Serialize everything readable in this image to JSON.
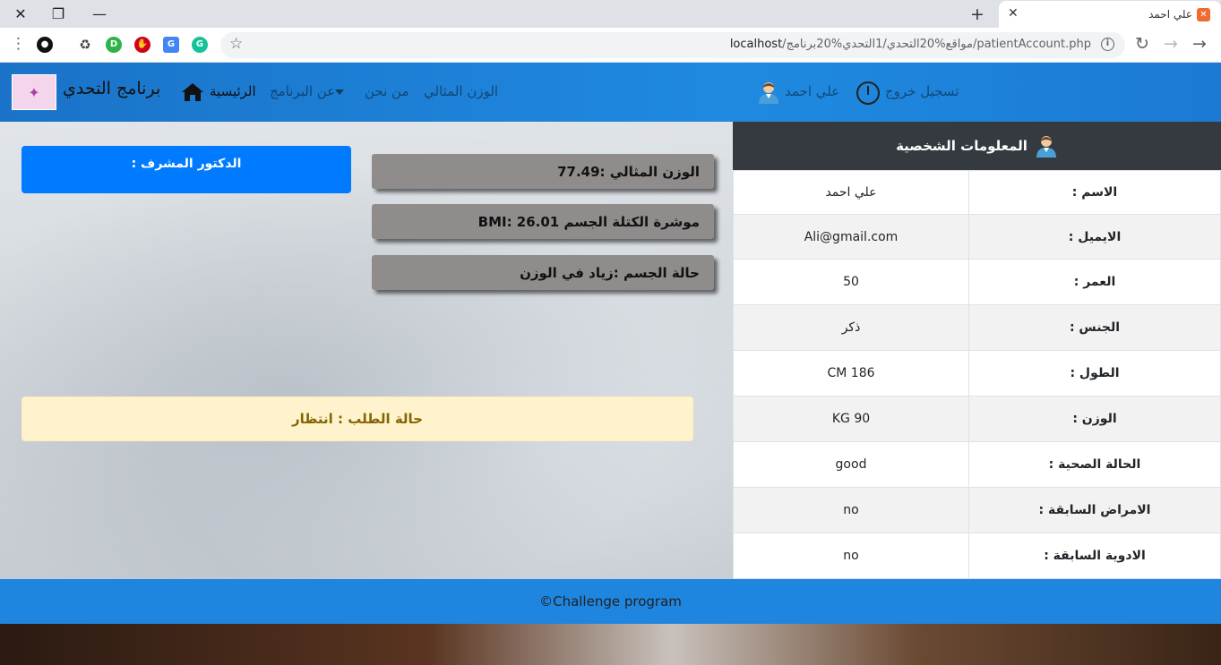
{
  "browser": {
    "tab_title": "علي احمد",
    "url_host": "localhost",
    "url_path": "/مواقع%20التحدي/1التحدي%20برنامج/patientAccount.php"
  },
  "navbar": {
    "brand": "برنامج التحدي",
    "links": [
      "الرئيسية",
      "عن البرنامج",
      "من نحن",
      "الوزن المثالي"
    ],
    "user_name": "علي احمد",
    "logout": "تسجيل خروج"
  },
  "info": {
    "title": "المعلومات الشخصية",
    "rows": [
      {
        "label": "الاسم :",
        "value": "علي احمد"
      },
      {
        "label": "الايميل :",
        "value": "Ali@gmail.com"
      },
      {
        "label": "العمر :",
        "value": "50"
      },
      {
        "label": "الجنس :",
        "value": "ذكر"
      },
      {
        "label": "الطول :",
        "value": "186 CM"
      },
      {
        "label": "الوزن :",
        "value": "90 KG"
      },
      {
        "label": "الحالة الصحية :",
        "value": "good"
      },
      {
        "label": "الامراض السابقة :",
        "value": "no"
      },
      {
        "label": "الادوية السابقة :",
        "value": "no"
      }
    ]
  },
  "stats": {
    "ideal_weight": "الوزن المثالي :77.49",
    "bmi": "موشرة الكتلة الجسم BMI: 26.01",
    "body_state": "حالة الجسم :زياد في الوزن"
  },
  "doctor": {
    "label": "الدكتور المشرف :"
  },
  "order": {
    "status": "حالة الطلب : انتظار"
  },
  "footer": {
    "text": "©Challenge program"
  },
  "colors": {
    "navbar": "#1f8ae0",
    "doctor": "#007bff",
    "info_head": "#343a40",
    "order_bg": "#fff3cd"
  }
}
